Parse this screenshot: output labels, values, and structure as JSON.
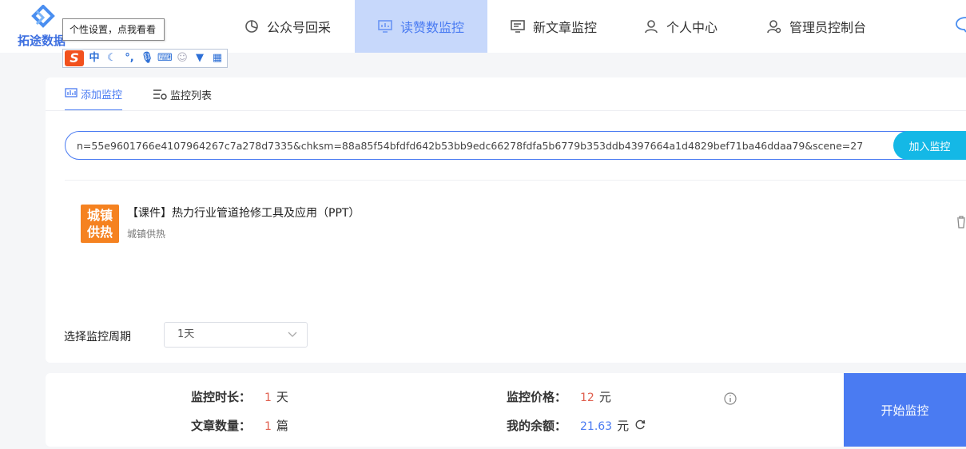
{
  "app": {
    "logo_text": "拓途数据",
    "tooltip": "个性设置，点我看看"
  },
  "nav": {
    "items": [
      {
        "label": "公众号回采",
        "icon": "pie-chart-icon"
      },
      {
        "label": "读赞数监控",
        "icon": "monitor-chart-icon",
        "active": true
      },
      {
        "label": "新文章监控",
        "icon": "screen-icon"
      },
      {
        "label": "个人中心",
        "icon": "user-icon"
      },
      {
        "label": "管理员控制台",
        "icon": "admin-user-icon"
      }
    ]
  },
  "ime": {
    "logo": "S",
    "mode": "中",
    "icons": [
      "moon-icon",
      "punctuation-icon",
      "microphone-icon",
      "keyboard-icon",
      "user-icon",
      "shirt-icon",
      "grid-icon"
    ]
  },
  "tabs": [
    {
      "label": "添加监控",
      "icon": "bar-chart-icon",
      "active": true
    },
    {
      "label": "监控列表",
      "icon": "list-icon"
    }
  ],
  "url_input": {
    "value": "n=55e9601766e4107964267c7a278d7335&chksm=88a85f54bfdfd642b53bb9edc66278fdfa5b6779b353ddb4397664a1d4829bef71ba46ddaa79&scene=27"
  },
  "add_button": "加入监控",
  "article": {
    "thumb_text": "城镇供热",
    "title": "【课件】热力行业管道抢修工具及应用（PPT）",
    "source": "城镇供热"
  },
  "period": {
    "label": "选择监控周期",
    "selected": "1天"
  },
  "summary": {
    "duration_label": "监控时长：",
    "duration_value": "1",
    "duration_unit": "天",
    "count_label": "文章数量：",
    "count_value": "1",
    "count_unit": "篇",
    "price_label": "监控价格：",
    "price_value": "12",
    "price_unit": "元",
    "balance_label": "我的余额：",
    "balance_value": "21.63",
    "balance_unit": "元"
  },
  "start_button": "开始监控",
  "colors": {
    "accent": "#4a7bf2",
    "add_button": "#14b8e6",
    "highlight_number": "#e0604f",
    "nav_active_bg": "#c7d8fb"
  }
}
